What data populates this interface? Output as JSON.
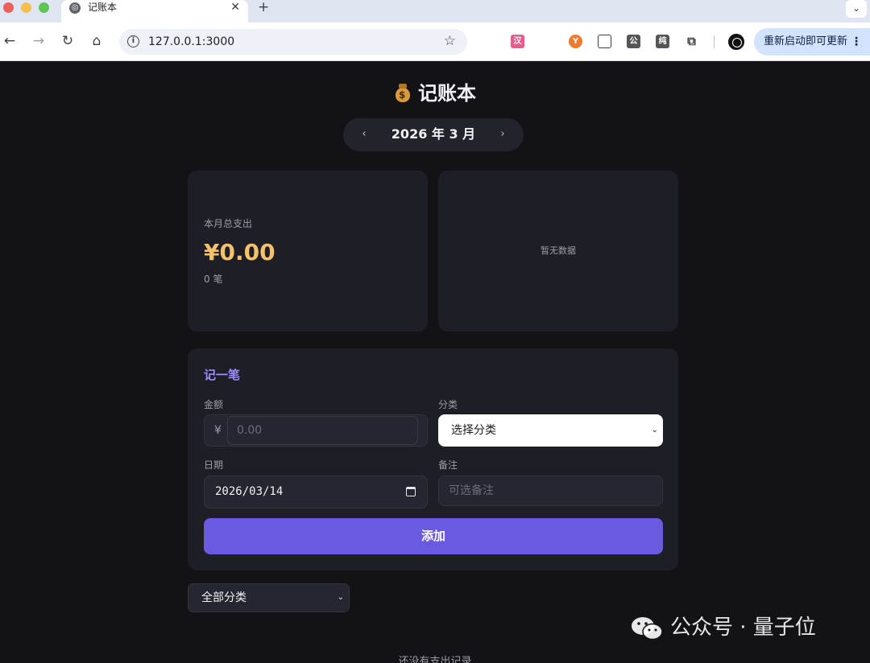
{
  "browser": {
    "tab_title": "记账本",
    "tab_close": "✕",
    "new_tab": "+",
    "url": "127.0.0.1:3000",
    "update_label": "重新启动即可更新",
    "ext_labels": [
      "",
      "汉",
      "",
      "Y",
      "",
      "公",
      "纯"
    ]
  },
  "app": {
    "title": "记账本",
    "month_label": "2026 年 3 月",
    "prev": "‹",
    "next": "›"
  },
  "summary": {
    "total_label": "本月总支出",
    "total_value": "¥0.00",
    "count": "0 笔",
    "chart_empty": "暂无数据"
  },
  "form": {
    "title": "记一笔",
    "amount_label": "金额",
    "currency": "¥",
    "amount_placeholder": "0.00",
    "category_label": "分类",
    "category_selected": "选择分类",
    "date_label": "日期",
    "date_value": "2026/03/14",
    "note_label": "备注",
    "note_placeholder": "可选备注",
    "add_label": "添加"
  },
  "filter": {
    "selected": "全部分类"
  },
  "list": {
    "empty": "还没有支出记录"
  },
  "watermark": {
    "text": "公众号 · 量子位"
  },
  "colors": {
    "accent": "#6a5ae0",
    "total": "#f5c26b",
    "form_title": "#9d8bff",
    "background": "#121217",
    "card": "#1e1e27"
  }
}
